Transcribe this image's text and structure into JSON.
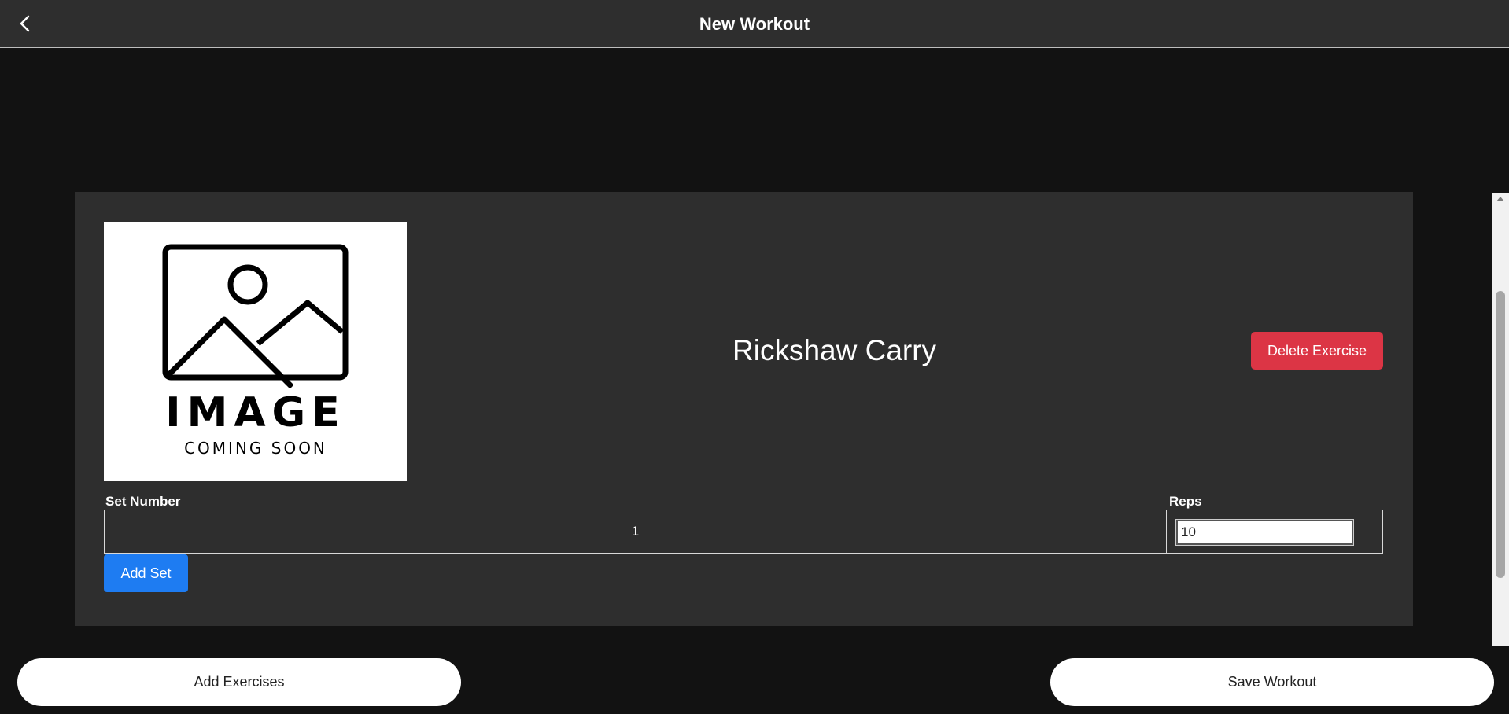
{
  "header": {
    "title": "New Workout",
    "back_icon": "chevron-left-icon"
  },
  "exercise": {
    "name": "Rickshaw Carry",
    "image_placeholder": {
      "icon": "image-placeholder-icon",
      "line1": "IMAGE",
      "line2": "COMING SOON"
    },
    "delete_label": "Delete Exercise",
    "table": {
      "headers": {
        "set_number": "Set Number",
        "reps": "Reps"
      },
      "rows": [
        {
          "set_number": "1",
          "reps": "10"
        }
      ]
    },
    "add_set_label": "Add Set"
  },
  "footer": {
    "add_exercises_label": "Add Exercises",
    "save_workout_label": "Save Workout"
  },
  "colors": {
    "delete": "#dc3545",
    "primary": "#1e7cf2",
    "card": "#2e2e2e",
    "background": "#121212"
  }
}
